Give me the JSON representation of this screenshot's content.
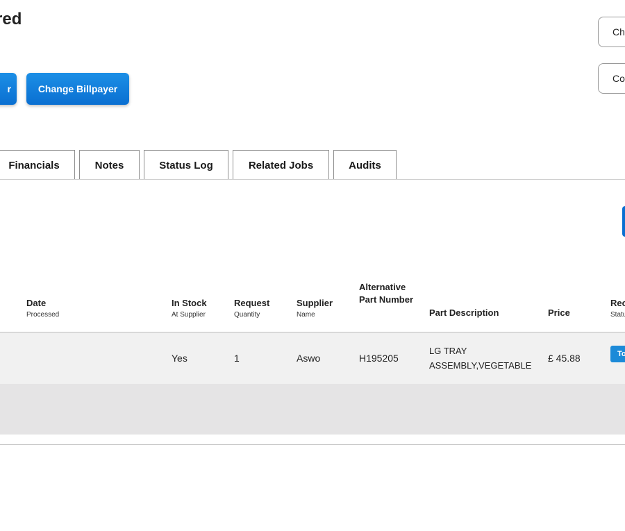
{
  "header": {
    "title_fragment": "red"
  },
  "actions": {
    "left_button_fragment": "r",
    "change_billpayer": "Change Billpayer",
    "right_button_1_fragment": "Ch",
    "right_button_2_fragment": "Co"
  },
  "tabs": [
    {
      "label": "Financials"
    },
    {
      "label": "Notes"
    },
    {
      "label": "Status Log"
    },
    {
      "label": "Related Jobs"
    },
    {
      "label": "Audits"
    }
  ],
  "table": {
    "columns": [
      {
        "label": "Date",
        "sub": "Processed"
      },
      {
        "label": "In Stock",
        "sub": "At Supplier"
      },
      {
        "label": "Request",
        "sub": "Quantity"
      },
      {
        "label": "Supplier",
        "sub": "Name"
      },
      {
        "label": "Alternative Part Number",
        "sub": ""
      },
      {
        "label": "Part Description",
        "sub": ""
      },
      {
        "label": "Price",
        "sub": ""
      },
      {
        "label": "Rec",
        "sub": "Statu"
      }
    ],
    "rows": [
      {
        "date_processed": "",
        "in_stock": "Yes",
        "quantity": "1",
        "supplier": "Aswo",
        "alt_part_number": "H195205",
        "description": "LG TRAY ASSEMBLY,VEGETABLE",
        "price": "£ 45.88",
        "status_badge": "To"
      }
    ]
  },
  "colors": {
    "accent": "#0a6fd1",
    "row_bg": "#f1f1f1",
    "row_alt_bg": "#e5e4e5"
  }
}
